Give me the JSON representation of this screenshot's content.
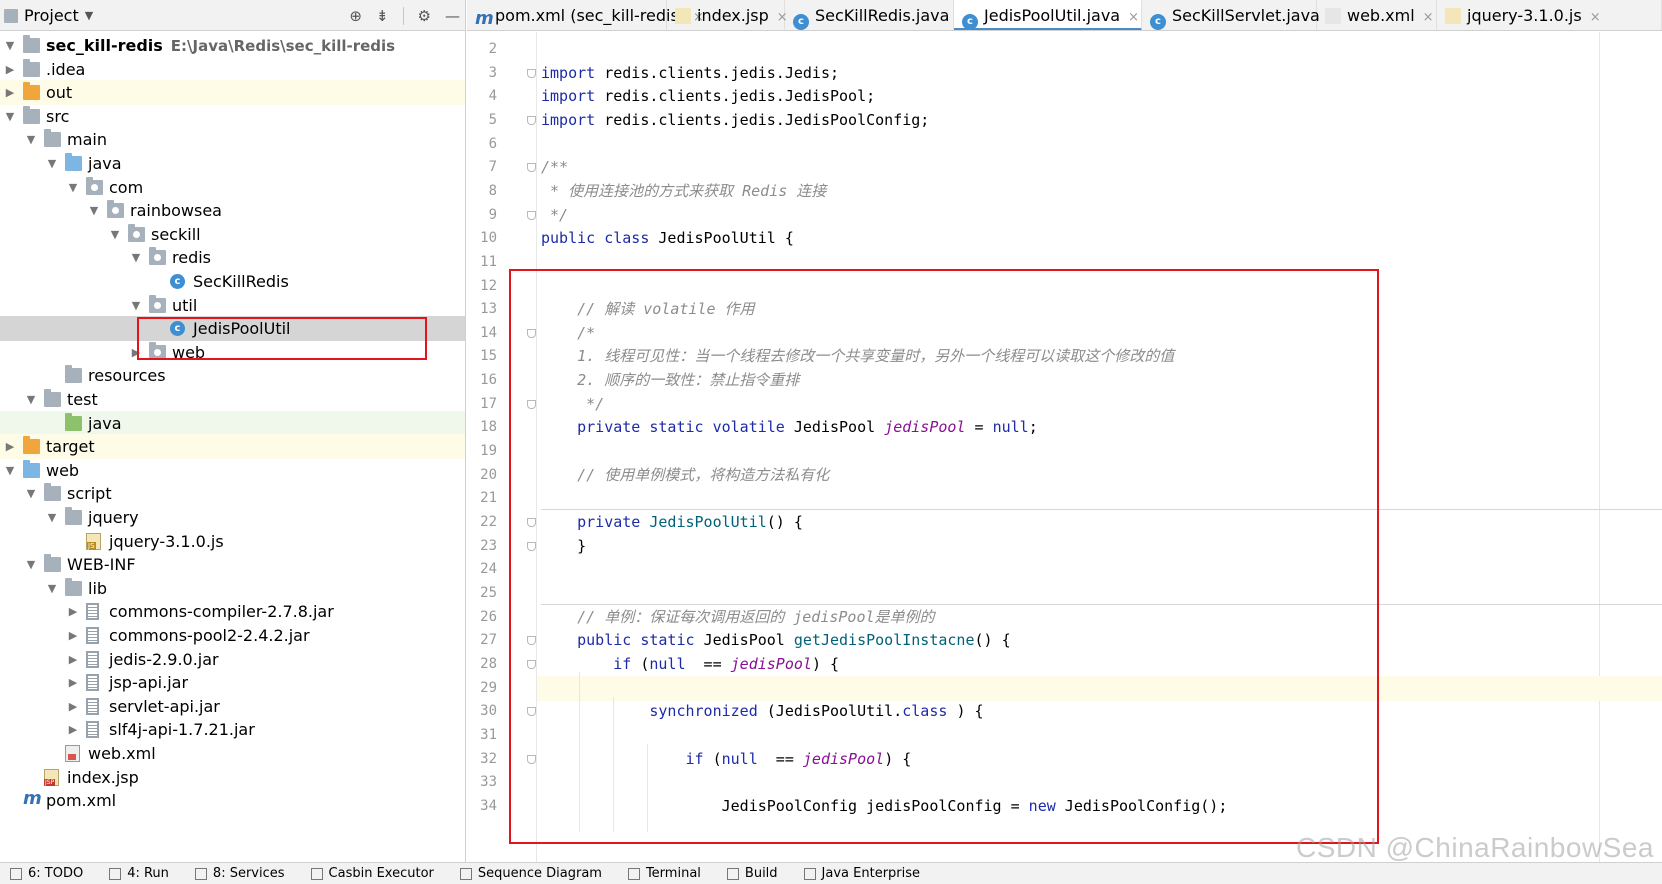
{
  "project_panel": {
    "title": "Project",
    "tools": [
      "globe-target-icon",
      "collapse-icon",
      "gear-icon",
      "minimize-icon"
    ]
  },
  "tree": [
    {
      "label": "sec_kill-redis",
      "path": "E:\\Java\\Redis\\sec_kill-redis",
      "indent": 0,
      "arrow": "down",
      "icon": "folder-grey",
      "bold": true
    },
    {
      "label": ".idea",
      "indent": 0,
      "arrow": "right",
      "icon": "folder-grey"
    },
    {
      "label": "out",
      "indent": 0,
      "arrow": "right",
      "icon": "folder-orange",
      "highlight": "yellow"
    },
    {
      "label": "src",
      "indent": 0,
      "arrow": "down",
      "icon": "folder-grey"
    },
    {
      "label": "main",
      "indent": 1,
      "arrow": "down",
      "icon": "folder-grey"
    },
    {
      "label": "java",
      "indent": 2,
      "arrow": "down",
      "icon": "folder-blue"
    },
    {
      "label": "com",
      "indent": 3,
      "arrow": "down",
      "icon": "package"
    },
    {
      "label": "rainbowsea",
      "indent": 4,
      "arrow": "down",
      "icon": "package"
    },
    {
      "label": "seckill",
      "indent": 5,
      "arrow": "down",
      "icon": "package"
    },
    {
      "label": "redis",
      "indent": 6,
      "arrow": "down",
      "icon": "package"
    },
    {
      "label": "SecKillRedis",
      "indent": 7,
      "arrow": "none",
      "icon": "class"
    },
    {
      "label": "util",
      "indent": 6,
      "arrow": "down",
      "icon": "package"
    },
    {
      "label": "JedisPoolUtil",
      "indent": 7,
      "arrow": "none",
      "icon": "class",
      "highlight": "selected"
    },
    {
      "label": "web",
      "indent": 6,
      "arrow": "right",
      "icon": "package"
    },
    {
      "label": "resources",
      "indent": 2,
      "arrow": "none",
      "icon": "folder-grey"
    },
    {
      "label": "test",
      "indent": 1,
      "arrow": "down",
      "icon": "folder-grey"
    },
    {
      "label": "java",
      "indent": 2,
      "arrow": "none",
      "icon": "folder-green",
      "highlight": "green"
    },
    {
      "label": "target",
      "indent": 0,
      "arrow": "right",
      "icon": "folder-orange",
      "highlight": "yellow"
    },
    {
      "label": "web",
      "indent": 0,
      "arrow": "down",
      "icon": "folder-blue"
    },
    {
      "label": "script",
      "indent": 1,
      "arrow": "down",
      "icon": "folder-grey"
    },
    {
      "label": "jquery",
      "indent": 2,
      "arrow": "down",
      "icon": "folder-grey"
    },
    {
      "label": "jquery-3.1.0.js",
      "indent": 3,
      "arrow": "none",
      "icon": "file-js"
    },
    {
      "label": "WEB-INF",
      "indent": 1,
      "arrow": "down",
      "icon": "folder-grey"
    },
    {
      "label": "lib",
      "indent": 2,
      "arrow": "down",
      "icon": "folder-grey"
    },
    {
      "label": "commons-compiler-2.7.8.jar",
      "indent": 3,
      "arrow": "right",
      "icon": "jar"
    },
    {
      "label": "commons-pool2-2.4.2.jar",
      "indent": 3,
      "arrow": "right",
      "icon": "jar"
    },
    {
      "label": "jedis-2.9.0.jar",
      "indent": 3,
      "arrow": "right",
      "icon": "jar"
    },
    {
      "label": "jsp-api.jar",
      "indent": 3,
      "arrow": "right",
      "icon": "jar"
    },
    {
      "label": "servlet-api.jar",
      "indent": 3,
      "arrow": "right",
      "icon": "jar"
    },
    {
      "label": "slf4j-api-1.7.21.jar",
      "indent": 3,
      "arrow": "right",
      "icon": "jar"
    },
    {
      "label": "web.xml",
      "indent": 2,
      "arrow": "none",
      "icon": "file-xml"
    },
    {
      "label": "index.jsp",
      "indent": 1,
      "arrow": "none",
      "icon": "file-jsp"
    },
    {
      "label": "pom.xml",
      "indent": 0,
      "arrow": "none",
      "icon": "maven"
    }
  ],
  "tabs": [
    {
      "label": "pom.xml (sec_kill-redis)",
      "icon": "maven",
      "active": false
    },
    {
      "label": "index.jsp",
      "icon": "jsp",
      "active": false
    },
    {
      "label": "SecKillRedis.java",
      "icon": "class",
      "active": false
    },
    {
      "label": "JedisPoolUtil.java",
      "icon": "class",
      "active": true
    },
    {
      "label": "SecKillServlet.java",
      "icon": "class",
      "active": false
    },
    {
      "label": "web.xml",
      "icon": "xml",
      "active": false
    },
    {
      "label": "jquery-3.1.0.js",
      "icon": "js",
      "active": false
    }
  ],
  "close_glyph": "×",
  "maven_glyph": "m",
  "class_glyph": "c",
  "editor": {
    "lines": [
      {
        "n": 2,
        "parts": []
      },
      {
        "n": 3,
        "parts": [
          [
            "kw",
            "import"
          ],
          [
            "",
            "redis.clients.jedis.Jedis;"
          ]
        ],
        "fold": true
      },
      {
        "n": 4,
        "parts": [
          [
            "kw",
            "import"
          ],
          [
            "",
            "redis.clients.jedis.JedisPool;"
          ]
        ]
      },
      {
        "n": 5,
        "parts": [
          [
            "kw",
            "import"
          ],
          [
            "",
            "redis.clients.jedis.JedisPoolConfig;"
          ]
        ],
        "fold": true
      },
      {
        "n": 6,
        "parts": []
      },
      {
        "n": 7,
        "parts": [
          [
            "cm",
            "/**"
          ]
        ],
        "fold": true
      },
      {
        "n": 8,
        "parts": [
          [
            "cm",
            " * 使用连接池的方式来获取 Redis 连接"
          ]
        ]
      },
      {
        "n": 9,
        "parts": [
          [
            "cm",
            " */"
          ]
        ],
        "fold": true
      },
      {
        "n": 10,
        "parts": [
          [
            "kw",
            "public class "
          ],
          [
            "",
            "JedisPoolUtil {"
          ]
        ]
      },
      {
        "n": 11,
        "parts": []
      },
      {
        "n": 12,
        "parts": []
      },
      {
        "n": 13,
        "parts": [
          [
            "cm",
            "    // 解读 volatile 作用"
          ]
        ]
      },
      {
        "n": 14,
        "parts": [
          [
            "cm",
            "    /*"
          ]
        ],
        "fold": true
      },
      {
        "n": 15,
        "parts": [
          [
            "cm",
            "    1. 线程可见性：当一个线程去修改一个共享变量时，另外一个线程可以读取这个修改的值"
          ]
        ]
      },
      {
        "n": 16,
        "parts": [
          [
            "cm",
            "    2. 顺序的一致性：禁止指令重排"
          ]
        ]
      },
      {
        "n": 17,
        "parts": [
          [
            "cm",
            "     */"
          ]
        ],
        "fold": true
      },
      {
        "n": 18,
        "parts": [
          [
            "kw",
            "    private static volatile "
          ],
          [
            "",
            "JedisPool "
          ],
          [
            "sf",
            "jedisPool"
          ],
          [
            "",
            " = "
          ],
          [
            "kw",
            "null"
          ],
          [
            "",
            ";"
          ]
        ]
      },
      {
        "n": 19,
        "parts": []
      },
      {
        "n": 20,
        "parts": [
          [
            "cm",
            "    // 使用单例模式，将构造方法私有化"
          ]
        ]
      },
      {
        "n": 21,
        "parts": []
      },
      {
        "n": 22,
        "parts": [
          [
            "kw",
            "    private "
          ],
          [
            "fn",
            "JedisPoolUtil"
          ],
          [
            "",
            "() {"
          ]
        ],
        "fold": true
      },
      {
        "n": 23,
        "parts": [
          [
            "",
            "    }"
          ]
        ],
        "fold": true
      },
      {
        "n": 24,
        "parts": []
      },
      {
        "n": 25,
        "parts": []
      },
      {
        "n": 26,
        "parts": [
          [
            "cm",
            "    // 单例：保证每次调用返回的 jedisPool是单例的"
          ]
        ]
      },
      {
        "n": 27,
        "parts": [
          [
            "kw",
            "    public static "
          ],
          [
            "",
            "JedisPool "
          ],
          [
            "fn",
            "getJedisPoolInstacne"
          ],
          [
            "",
            "() {"
          ]
        ],
        "fold": true
      },
      {
        "n": 28,
        "parts": [
          [
            "kw",
            "        if "
          ],
          [
            "",
            "("
          ],
          [
            "kw",
            "null"
          ],
          [
            "",
            " == "
          ],
          [
            "sf",
            "jedisPool"
          ],
          [
            "",
            ") {"
          ]
        ],
        "fold": true
      },
      {
        "n": 29,
        "parts": []
      },
      {
        "n": 30,
        "parts": [
          [
            "kw",
            "            synchronized "
          ],
          [
            "",
            "(JedisPoolUtil."
          ],
          [
            "kw",
            "class"
          ],
          [
            "",
            ") {"
          ]
        ],
        "fold": true
      },
      {
        "n": 31,
        "parts": []
      },
      {
        "n": 32,
        "parts": [
          [
            "kw",
            "                if "
          ],
          [
            "",
            "("
          ],
          [
            "kw",
            "null"
          ],
          [
            "",
            " == "
          ],
          [
            "sf",
            "jedisPool"
          ],
          [
            "",
            ") {"
          ]
        ],
        "fold": true
      },
      {
        "n": 33,
        "parts": []
      },
      {
        "n": 34,
        "parts": [
          [
            "",
            "                    JedisPoolConfig jedisPoolConfig = "
          ],
          [
            "kw",
            "new "
          ],
          [
            "",
            "JedisPoolConfig();"
          ]
        ]
      }
    ]
  },
  "statusbar": [
    {
      "label": "6: TODO",
      "icon": "todo-icon"
    },
    {
      "label": "4: Run",
      "icon": "run-icon"
    },
    {
      "label": "8: Services",
      "icon": "services-icon"
    },
    {
      "label": "Casbin Executor",
      "icon": "casbin-icon"
    },
    {
      "label": "Sequence Diagram",
      "icon": "sequence-icon"
    },
    {
      "label": "Terminal",
      "icon": "terminal-icon"
    },
    {
      "label": "Build",
      "icon": "build-icon"
    },
    {
      "label": "Java Enterprise",
      "icon": "java-enterprise-icon"
    }
  ],
  "watermark": "CSDN @ChinaRainbowSea",
  "colors": {
    "keyword": "#1d2ba8",
    "comment": "#8c8c8c",
    "static_field": "#871094",
    "method": "#00627a",
    "annotation_box": "#e3141c",
    "selection": "#d5d5d5"
  }
}
